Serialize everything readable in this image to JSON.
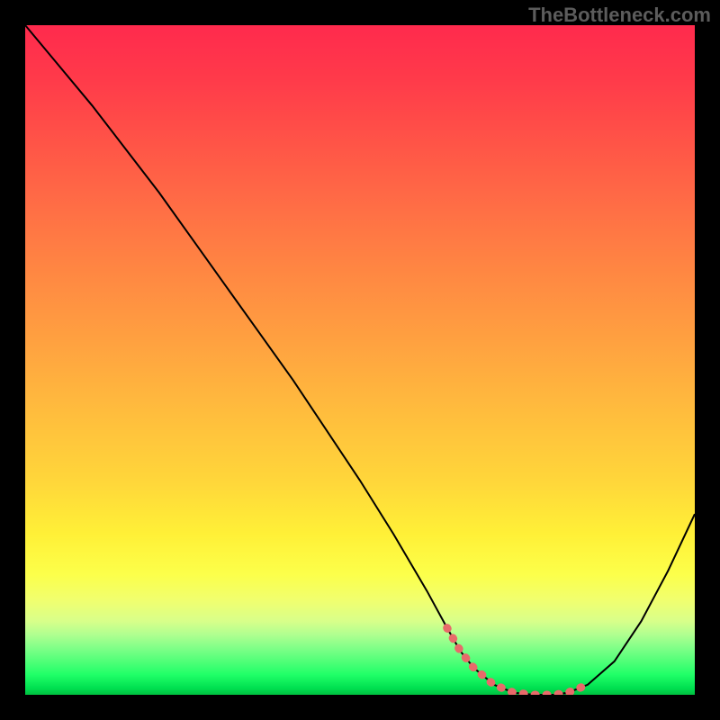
{
  "watermark": "TheBottleneck.com",
  "chart_data": {
    "type": "line",
    "title": "",
    "xlabel": "",
    "ylabel": "",
    "xlim": [
      0,
      100
    ],
    "ylim": [
      0,
      100
    ],
    "x": [
      0,
      5,
      10,
      15,
      20,
      25,
      30,
      35,
      40,
      45,
      50,
      55,
      60,
      63,
      65,
      67,
      70,
      73,
      76,
      79,
      81,
      84,
      88,
      92,
      96,
      100
    ],
    "values": [
      100,
      94,
      88,
      81.5,
      75,
      68,
      61,
      54,
      47,
      39.5,
      32,
      24,
      15.5,
      10,
      6.5,
      4,
      1.5,
      0.3,
      0,
      0,
      0.3,
      1.5,
      5,
      11,
      18.5,
      27
    ],
    "highlight_segment": {
      "color": "#e86a6a",
      "x": [
        63,
        65,
        67,
        70,
        73,
        76,
        79,
        81,
        84
      ],
      "values": [
        10,
        6.5,
        4,
        1.5,
        0.3,
        0,
        0,
        0.3,
        1.5
      ]
    },
    "gradient_stops": [
      {
        "pos": 0,
        "color": "#ff2a4d"
      },
      {
        "pos": 50,
        "color": "#ffa340"
      },
      {
        "pos": 80,
        "color": "#fff037"
      },
      {
        "pos": 100,
        "color": "#00c040"
      }
    ]
  }
}
